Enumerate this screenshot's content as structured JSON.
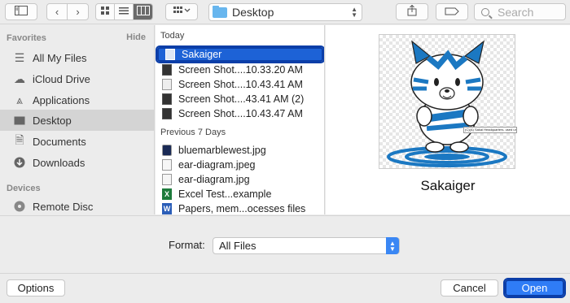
{
  "toolbar": {
    "sidebar_toggle_icon": "sidebar-icon",
    "back_icon": "chevron-left",
    "forward_icon": "chevron-right",
    "view_icons": [
      "icon-view",
      "list-view",
      "column-view"
    ],
    "arrange_icon": "arrange-grid",
    "location": "Desktop",
    "search_placeholder": "Search"
  },
  "sidebar": {
    "favorites_header": "Favorites",
    "hide_label": "Hide",
    "favorites": [
      {
        "label": "All My Files",
        "icon": "all-files-icon"
      },
      {
        "label": "iCloud Drive",
        "icon": "cloud-icon"
      },
      {
        "label": "Applications",
        "icon": "applications-icon"
      },
      {
        "label": "Desktop",
        "icon": "desktop-icon",
        "selected": true
      },
      {
        "label": "Documents",
        "icon": "documents-icon"
      },
      {
        "label": "Downloads",
        "icon": "downloads-icon"
      }
    ],
    "devices_header": "Devices",
    "devices": [
      {
        "label": "Remote Disc",
        "icon": "disc-icon"
      }
    ]
  },
  "files": {
    "today_header": "Today",
    "today": [
      {
        "name": "Sakaiger",
        "selected": true
      },
      {
        "name": "Screen Shot....10.33.20 AM"
      },
      {
        "name": "Screen Shot....10.43.41 AM"
      },
      {
        "name": "Screen Shot....43.41 AM (2)"
      },
      {
        "name": "Screen Shot....10.43.47 AM"
      }
    ],
    "previous_header": "Previous 7 Days",
    "previous": [
      {
        "name": "bluemarblewest.jpg"
      },
      {
        "name": "ear-diagram.jpeg"
      },
      {
        "name": "ear-diagram.jpg"
      },
      {
        "name": "Excel Test...example"
      },
      {
        "name": "Papers, mem...ocesses files"
      }
    ]
  },
  "preview": {
    "name": "Sakaiger",
    "caption_text": "(C)(A) Sakai Headquarters, used under fair use"
  },
  "format": {
    "label": "Format:",
    "selected": "All Files"
  },
  "buttons": {
    "options": "Options",
    "cancel": "Cancel",
    "open": "Open"
  },
  "colors": {
    "selection": "#1d62d6",
    "highlight_outline": "#0b3ea8",
    "primary_button": "#2f7cf6",
    "folder": "#68b6ee"
  }
}
